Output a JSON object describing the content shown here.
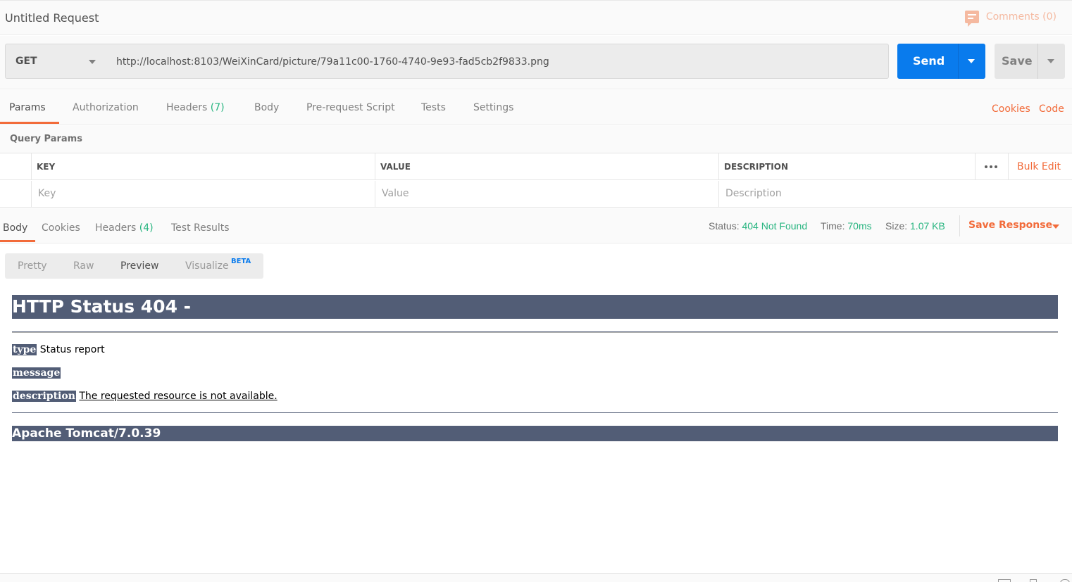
{
  "header": {
    "title": "Untitled Request",
    "comments_label": "Comments (0)"
  },
  "request": {
    "method": "GET",
    "url": "http://localhost:8103/WeiXinCard/picture/79a11c00-1760-4740-9e93-fad5cb2f9833.png",
    "send_label": "Send",
    "save_label": "Save"
  },
  "request_tabs": {
    "params": "Params",
    "authorization": "Authorization",
    "headers": "Headers",
    "headers_count": "(7)",
    "body": "Body",
    "pre_request": "Pre-request Script",
    "tests": "Tests",
    "settings": "Settings",
    "cookies": "Cookies",
    "code": "Code"
  },
  "query_params": {
    "title": "Query Params",
    "columns": [
      "KEY",
      "VALUE",
      "DESCRIPTION"
    ],
    "placeholders": [
      "Key",
      "Value",
      "Description"
    ],
    "bulk_edit": "Bulk Edit"
  },
  "response_tabs": {
    "body": "Body",
    "cookies": "Cookies",
    "headers": "Headers",
    "headers_count": "(4)",
    "test_results": "Test Results"
  },
  "response_meta": {
    "status_label": "Status:",
    "status_value": "404 Not Found",
    "time_label": "Time:",
    "time_value": "70ms",
    "size_label": "Size:",
    "size_value": "1.07 KB",
    "save_response": "Save Response"
  },
  "view_modes": {
    "pretty": "Pretty",
    "raw": "Raw",
    "preview": "Preview",
    "visualize": "Visualize",
    "beta": "BETA"
  },
  "preview": {
    "heading": "HTTP Status 404 -",
    "type_label": "type",
    "type_value": "Status report",
    "message_label": "message",
    "description_label": "description",
    "description_value": "The requested resource is not available.",
    "footer": "Apache Tomcat/7.0.39"
  },
  "colors": {
    "accent_orange": "#f26b3a",
    "send_blue": "#097bed",
    "status_green": "#26b47f",
    "tomcat_bar": "#525d76"
  }
}
